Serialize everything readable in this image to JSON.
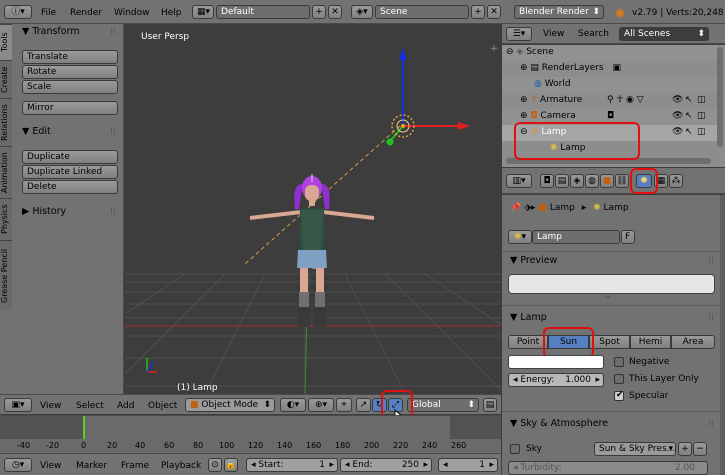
{
  "top_menu": {
    "items": [
      "File",
      "Render",
      "Window",
      "Help"
    ]
  },
  "screen_layout": {
    "value": "Default"
  },
  "scene_selector": {
    "value": "Scene"
  },
  "render_engine": {
    "value": "Blender Render"
  },
  "version_stats": "v2.79 | Verts:20,248",
  "tool_tabs": [
    "Tools",
    "Create",
    "Relations",
    "Animation",
    "Physics",
    "Grease Pencil"
  ],
  "tool_shelf": {
    "transform_header": "Transform",
    "transform_buttons": [
      "Translate",
      "Rotate",
      "Scale"
    ],
    "mirror_button": "Mirror",
    "edit_header": "Edit",
    "edit_buttons": [
      "Duplicate",
      "Duplicate Linked",
      "Delete"
    ],
    "history_header": "History"
  },
  "viewport": {
    "view_label": "User Persp",
    "object_label": "(1) Lamp"
  },
  "viewport_header": {
    "view": "View",
    "select": "Select",
    "add": "Add",
    "object": "Object",
    "mode": "Object Mode",
    "orientation": "Global"
  },
  "timeline": {
    "ticks": [
      "-40",
      "-20",
      "0",
      "20",
      "40",
      "60",
      "80",
      "100",
      "120",
      "140",
      "160",
      "180",
      "200",
      "220",
      "240",
      "260"
    ],
    "menu": [
      "View",
      "Marker",
      "Frame",
      "Playback"
    ],
    "start_label": "Start:",
    "start_value": "1",
    "end_label": "End:",
    "end_value": "250",
    "current_frame": "1"
  },
  "outliner": {
    "view": "View",
    "search": "Search",
    "filter": "All Scenes",
    "items": [
      "Scene",
      "RenderLayers",
      "World",
      "Armature",
      "Camera",
      "Lamp",
      "Lamp"
    ]
  },
  "properties": {
    "breadcrumb_object": "Lamp",
    "breadcrumb_data": "Lamp",
    "datablock_name": "Lamp",
    "datablock_fake": "F",
    "preview_header": "Preview",
    "lamp_header": "Lamp",
    "lamp_types": [
      "Point",
      "Sun",
      "Spot",
      "Hemi",
      "Area"
    ],
    "selected_type": "Sun",
    "energy_label": "Energy:",
    "energy_value": "1.000",
    "negative_label": "Negative",
    "this_layer_label": "This Layer Only",
    "specular_label": "Specular",
    "sky_header": "Sky & Atmosphere",
    "sky_label": "Sky",
    "sky_preset": "Sun & Sky Pres...",
    "turbidity_label": "Turbidity:",
    "turbidity_value": "2.00"
  },
  "colors": {
    "highlight_red": "#e01010",
    "selected_blue": "#5680c2",
    "axis_x": "#e02020",
    "axis_y": "#20c020",
    "axis_z": "#1030e0",
    "hair": "#b040e0"
  }
}
